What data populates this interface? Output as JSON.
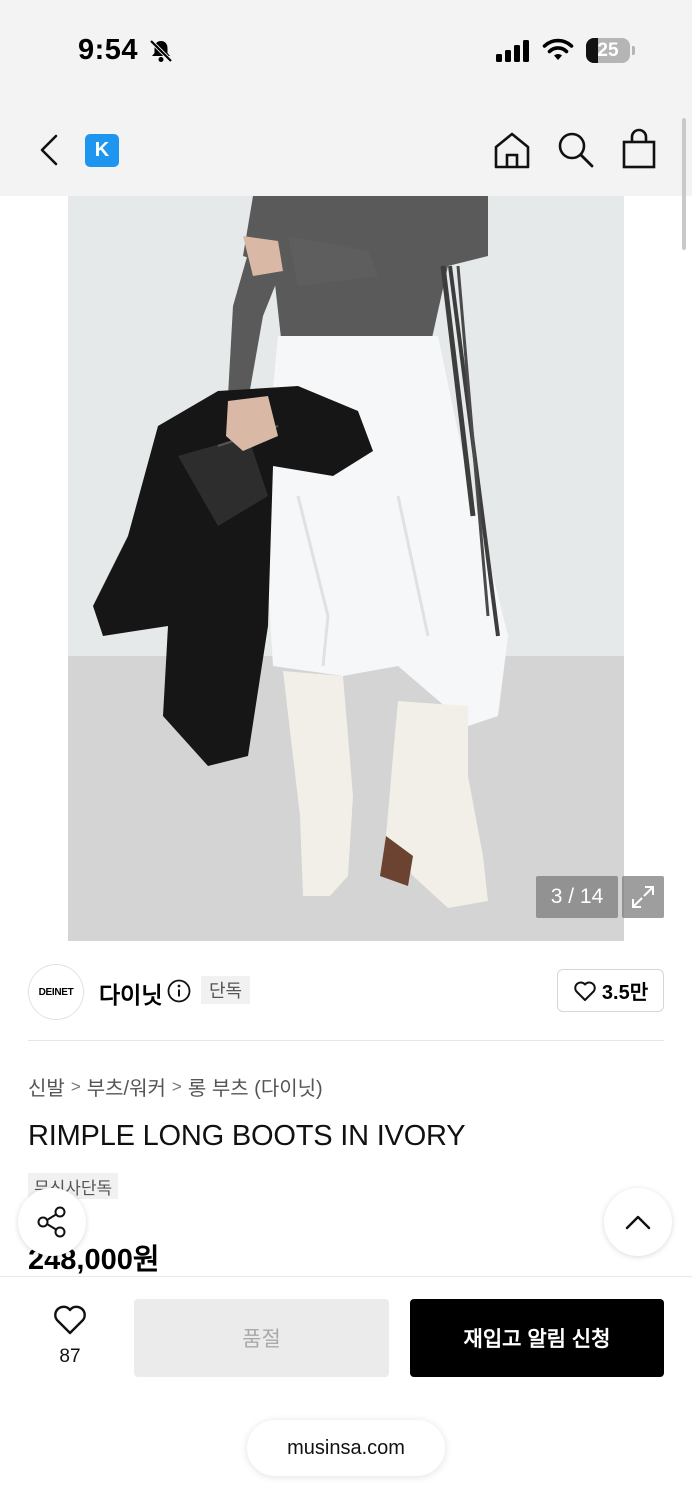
{
  "status_bar": {
    "time": "9:54",
    "battery": "25"
  },
  "colors": {
    "logo_blue": "#1e96f0",
    "primary_button": "#000000",
    "disabled_button": "#ebebeb"
  },
  "header": {
    "logo_letter": "K",
    "icons": [
      "back-icon",
      "home-icon",
      "search-icon",
      "bag-icon"
    ]
  },
  "gallery": {
    "counter": "3 / 14"
  },
  "brand": {
    "logo_text": "DEINET",
    "name": "다이닛",
    "badge": "단독",
    "likes": "3.5만"
  },
  "breadcrumb": [
    "신발",
    "부츠/워커",
    "롱 부츠 (다이닛)"
  ],
  "product": {
    "title": "RIMPLE LONG BOOTS IN IVORY",
    "badge": "무신사단독",
    "price": "248,000원"
  },
  "bottom_bar": {
    "wish_count": "87",
    "soldout_label": "품절",
    "restock_label": "재입고 알림 신청"
  },
  "browser": {
    "url": "musinsa.com"
  }
}
